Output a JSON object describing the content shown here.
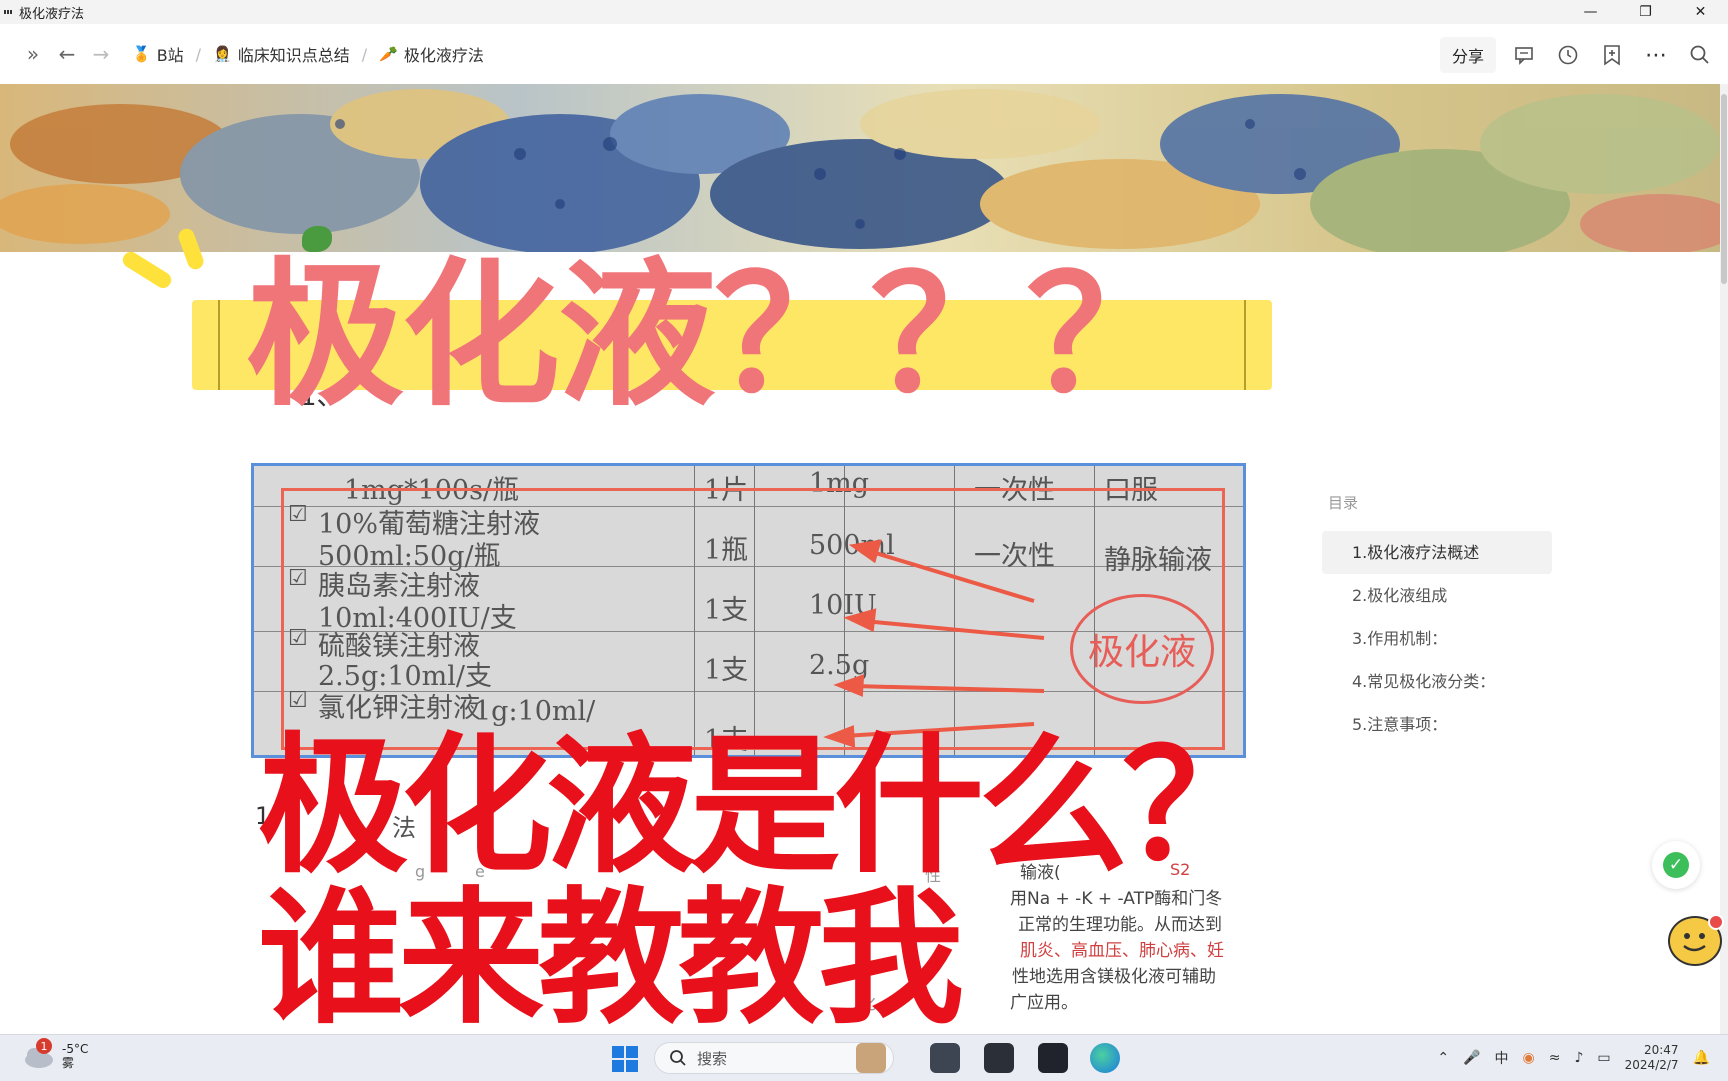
{
  "window": {
    "title": "极化液疗法"
  },
  "toolbar": {
    "breadcrumbs": [
      {
        "icon": "🏅",
        "label": "B站"
      },
      {
        "icon": "👩‍⚕️",
        "label": "临床知识点总结"
      },
      {
        "icon": "🥕",
        "label": "极化液疗法"
      }
    ],
    "share_label": "分享"
  },
  "document": {
    "cover_title": "极化液？？？",
    "faint_heading": "1、",
    "section_number": "1",
    "paragraph_fragments": [
      "输液(",
      "用Na + -K + -ATP酶和门冬",
      "正常的生理功能。从而达到",
      "肌炎、高血压、肺心病、妊",
      "性地选用含镁极化液可辅助",
      "广应用。"
    ],
    "left_fragments": [
      "法",
      "g",
      "e",
      "性",
      "S2",
      "化"
    ]
  },
  "prescription": {
    "top_row": [
      "1mg*100s/瓶",
      "1片",
      "1mg",
      "一次性",
      "口服"
    ],
    "rows": [
      {
        "name": "10%葡萄糖注射液",
        "spec": "500ml:50g/瓶",
        "qty": "1瓶",
        "dose": "500ml",
        "freq": "一次性",
        "route": "静脉输液"
      },
      {
        "name": "胰岛素注射液",
        "spec": "10ml:400IU/支",
        "qty": "1支",
        "dose": "10IU"
      },
      {
        "name": "硫酸镁注射液",
        "spec": "2.5g:10ml/支",
        "qty": "1支",
        "dose": "2.5g"
      },
      {
        "name": "氯化钾注射液",
        "spec": "1g:10ml/",
        "qty": "1支",
        "dose": ""
      }
    ],
    "stamp": "极化液"
  },
  "caption": {
    "line1": "极化液是什么？",
    "line2": "谁来教教我"
  },
  "toc": {
    "title": "目录",
    "items": [
      "1.极化液疗法概述",
      "2.极化液组成",
      "3.作用机制：",
      "4.常见极化液分类：",
      "5.注意事项："
    ]
  },
  "taskbar": {
    "weather_badge": "1",
    "temperature": "-5°C",
    "weather_text": "雾",
    "search_placeholder": "搜索",
    "time": "20:47",
    "date": "2024/2/7",
    "ime": "中"
  },
  "colors": {
    "title_pink": "#f07579",
    "caption_red": "#e8101a",
    "highlight_yellow": "#ffe766",
    "stamp_red": "#e75e58"
  }
}
